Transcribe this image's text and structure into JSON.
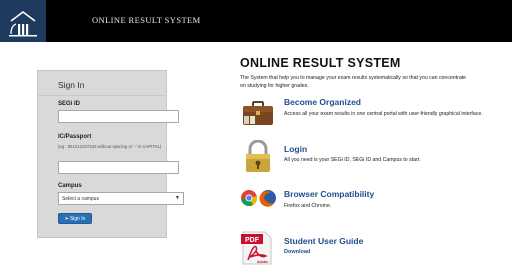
{
  "header": {
    "title": "ONLINE RESULT SYSTEM",
    "logo_icon": "building-pillars-icon"
  },
  "signin": {
    "title": "Sign In",
    "segi_id_label": "SEGi ID",
    "segi_id_value": "",
    "ic_label": "IC/Passport",
    "ic_hint": "(eg : 851212107222 without spacing or '-' in CAPITAL)",
    "ic_value": "",
    "campus_label": "Campus",
    "campus_selected": "Select a campus",
    "signin_button": "Sign In"
  },
  "main": {
    "title": "ONLINE RESULT SYSTEM",
    "description": "The System that help you to manage your exam results systematically so that you can concentrate on studying for higher grades.",
    "features": [
      {
        "title": "Become Organized",
        "description": "Access all your exam results in one central portal with user-friendly graphical interface.",
        "icon": "briefcase-icon"
      },
      {
        "title": "Login",
        "description": "All you need is your SEGi ID, SEGi ID and Campus to start.",
        "icon": "lock-icon"
      },
      {
        "title": "Browser Compatibility",
        "description": "Firefox and Chrome.",
        "icon": "browser-icon"
      },
      {
        "title": "Student User Guide",
        "link": "Download",
        "icon": "pdf-icon"
      }
    ]
  },
  "colors": {
    "header_bg": "#000000",
    "logo_bg": "#1f3a5f",
    "accent": "#1f4e8c",
    "button": "#2a6fb5"
  }
}
